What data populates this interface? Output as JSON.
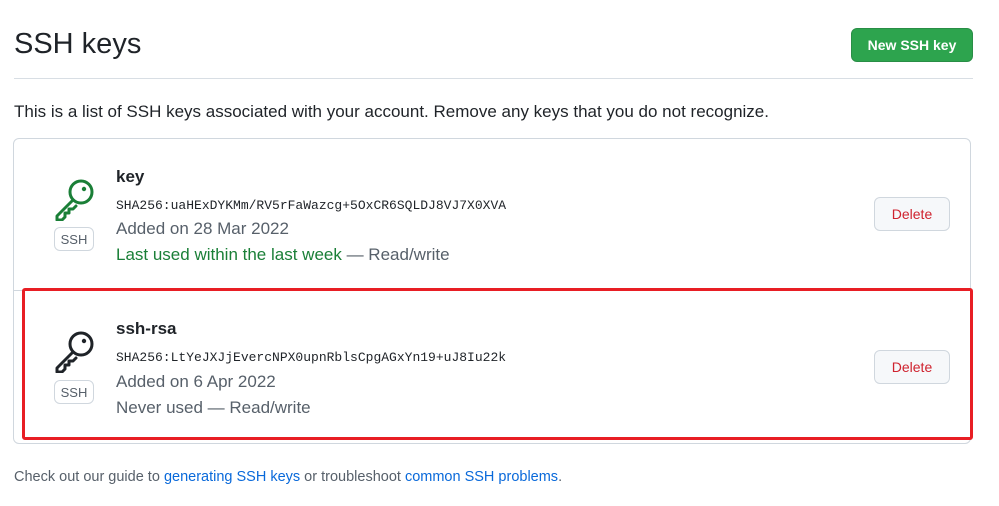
{
  "header": {
    "title": "SSH keys",
    "new_key_label": "New SSH key"
  },
  "intro_text": "This is a list of SSH keys associated with your account. Remove any keys that you do not recognize.",
  "keys": [
    {
      "title": "key",
      "fingerprint": "SHA256:uaHExDYKMm/RV5rFaWazcg+5OxCR6SQLDJ8VJ7X0XVA",
      "added": "Added on 28 Mar 2022",
      "last_used": "Last used within the last week",
      "access": " — Read/write",
      "badge": "SSH",
      "delete_label": "Delete",
      "icon": "key-icon",
      "icon_color": "#1a7f37"
    },
    {
      "title": "ssh-rsa",
      "fingerprint": "SHA256:LtYeJXJjEvercNPX0upnRblsCpgAGxYn19+uJ8Iu22k",
      "added": "Added on 6 Apr 2022",
      "last_used": "Never used",
      "access": " — Read/write",
      "badge": "SSH",
      "delete_label": "Delete",
      "icon": "key-icon",
      "icon_color": "#1f2328"
    }
  ],
  "footer": {
    "prefix": "Check out our guide to ",
    "link1": "generating SSH keys",
    "middle": " or troubleshoot ",
    "link2": "common SSH problems",
    "suffix": "."
  },
  "colors": {
    "primary_button": "#2da44e",
    "danger": "#cf222e",
    "link": "#0969da",
    "highlight": "#e81e24"
  }
}
